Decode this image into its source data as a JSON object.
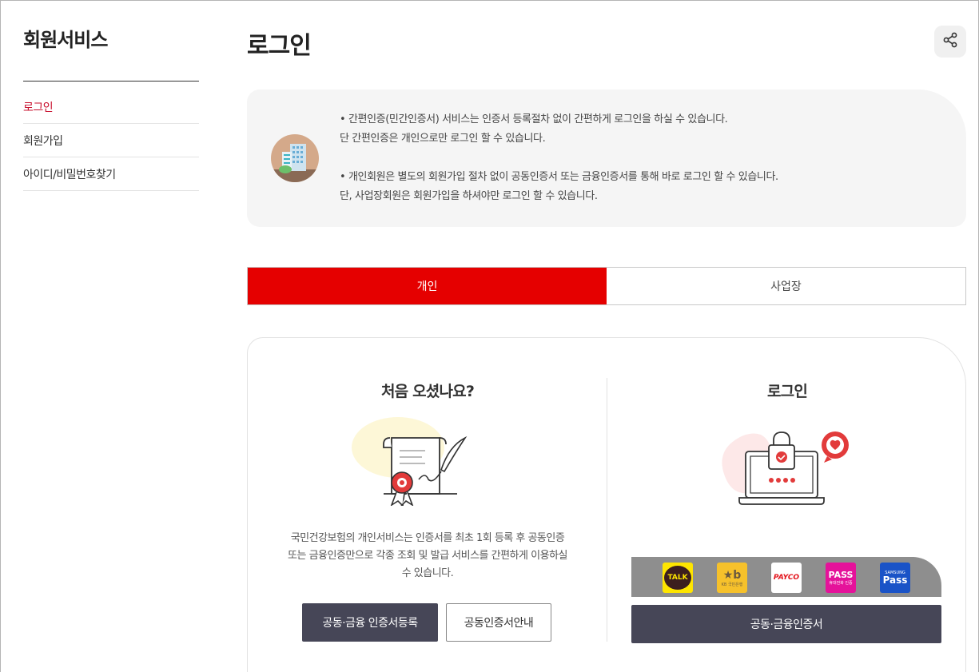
{
  "sidebar": {
    "title": "회원서비스",
    "items": [
      {
        "label": "로그인",
        "active": true
      },
      {
        "label": "회원가입",
        "active": false
      },
      {
        "label": "아이디/비밀번호찾기",
        "active": false
      }
    ]
  },
  "header": {
    "title": "로그인",
    "share_icon": "share-icon"
  },
  "notice": {
    "icon": "building-icon",
    "lines": [
      "•  간편인증(민간인증서) 서비스는 인증서 등록절차 없이 간편하게 로그인을 하실 수 있습니다.",
      "단 간편인증은 개인으로만 로그인 할 수 있습니다.",
      "•  개인회원은 별도의 회원가입 절차 없이 공동인증서 또는 금융인증서를 통해 바로 로그인 할 수 있습니다.",
      "단, 사업장회원은 회원가입을 하셔야만 로그인 할 수 있습니다."
    ]
  },
  "tabs": [
    {
      "label": "개인",
      "active": true
    },
    {
      "label": "사업장",
      "active": false
    }
  ],
  "first_visit": {
    "title": "처음 오셨나요?",
    "description": [
      "국민건강보험의 개인서비스는 인증서를 최초 1회 등록 후 공동인증",
      "또는 금융인증만으로 각종 조회 및 발급 서비스를 간편하게 이용하실",
      "수 있습니다."
    ],
    "register_button": "공동·금융 인증서등록",
    "guide_button": "공동인증서안내"
  },
  "login": {
    "title": "로그인",
    "providers": [
      {
        "name": "kakao-talk",
        "label": "TALK",
        "bg": "#fee500",
        "fg": "#3c1e1e"
      },
      {
        "name": "kb",
        "label": "★b",
        "sublabel": "KB 국민은행",
        "bg": "#f6c12b",
        "fg": "#6b5a3e"
      },
      {
        "name": "payco",
        "label": "PAYCO",
        "bg": "#ffffff",
        "fg": "#e3131b"
      },
      {
        "name": "pass",
        "label": "PASS",
        "sublabel": "휴대전화 인증",
        "bg": "#e5129a",
        "fg": "#ffffff"
      },
      {
        "name": "samsung-pass",
        "label": "Pass",
        "sublabel": "SAMSUNG",
        "bg": "#1a53c7",
        "fg": "#ffffff"
      }
    ],
    "cert_button": "공동·금융인증서"
  },
  "colors": {
    "accent": "#e50000",
    "sidebar_active": "#c8102e",
    "dark_button": "#464657"
  }
}
